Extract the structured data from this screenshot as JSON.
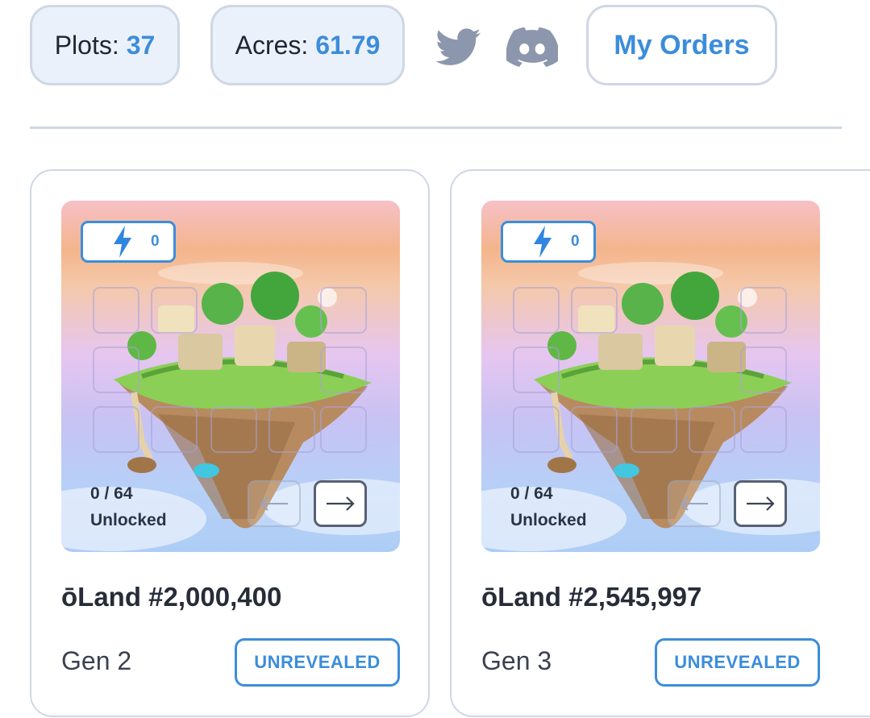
{
  "stats": {
    "plots_label": "Plots:",
    "plots_value": "37",
    "acres_label": "Acres:",
    "acres_value": "61.79"
  },
  "social": {
    "twitter_icon": "twitter-icon",
    "discord_icon": "discord-icon"
  },
  "orders_button": "My Orders",
  "colors": {
    "accent": "#3b8ddb",
    "border": "#cfd7e5",
    "pill_bg": "#ebf1fa",
    "icon_gray": "#8c97ad"
  },
  "cards": [
    {
      "energy": "0",
      "unlocked_count": "0 / 64",
      "unlocked_label": "Unlocked",
      "title": "ōLand #2,000,400",
      "gen": "Gen 2",
      "status": "UNREVEALED"
    },
    {
      "energy": "0",
      "unlocked_count": "0 / 64",
      "unlocked_label": "Unlocked",
      "title": "ōLand #2,545,997",
      "gen": "Gen 3",
      "status": "UNREVEALED"
    }
  ]
}
